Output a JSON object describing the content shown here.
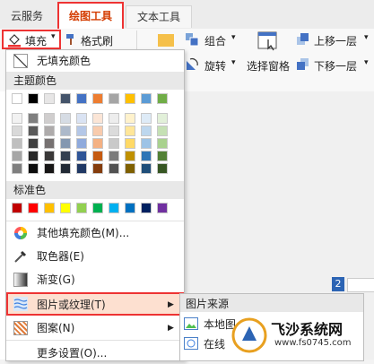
{
  "tabs": [
    "云服务",
    "绘图工具",
    "文本工具"
  ],
  "ribbon": {
    "fill_label": "填充",
    "format_painter_label": "格式刷",
    "group_label": "组合",
    "rotate_label": "旋转",
    "selection_pane_label": "选择窗格",
    "bring_forward_label": "上移一层",
    "send_backward_label": "下移一层"
  },
  "menu": {
    "no_fill": "无填充颜色",
    "theme_colors": "主题颜色",
    "standard_colors": "标准色",
    "more_colors": "其他填充颜色(M)...",
    "eyedropper": "取色器(E)",
    "gradient": "渐变(G)",
    "picture_texture": "图片或纹理(T)",
    "pattern": "图案(N)",
    "more_settings": "更多设置(O)..."
  },
  "submenu": {
    "header": "图片来源",
    "local": "本地图",
    "online": "在线"
  },
  "status": {
    "page_number": "2"
  },
  "watermark": {
    "name": "飞沙系统网",
    "url": "www.fs0745.com"
  },
  "colors": {
    "theme_top": [
      "#ffffff",
      "#000000",
      "#e7e6e6",
      "#44546a",
      "#4472c4",
      "#ed7d31",
      "#a5a5a5",
      "#ffc000",
      "#5b9bd5",
      "#70ad47"
    ],
    "theme_shades": [
      [
        "#f2f2f2",
        "#7f7f7f",
        "#d0cece",
        "#d6dce4",
        "#dae3f3",
        "#fbe5d6",
        "#ededed",
        "#fff2cc",
        "#deebf7",
        "#e2f0d9"
      ],
      [
        "#d9d9d9",
        "#595959",
        "#aeabab",
        "#adb9ca",
        "#b4c7e7",
        "#f8cbad",
        "#dbdbdb",
        "#ffe699",
        "#bdd7ee",
        "#c5e0b4"
      ],
      [
        "#bfbfbf",
        "#404040",
        "#767171",
        "#8497b0",
        "#8faadc",
        "#f4b183",
        "#c9c9c9",
        "#ffd966",
        "#9dc3e6",
        "#a9d18e"
      ],
      [
        "#a6a6a6",
        "#262626",
        "#3a3838",
        "#333f50",
        "#2f5597",
        "#c55a11",
        "#7b7b7b",
        "#bf9000",
        "#2e75b6",
        "#538135"
      ],
      [
        "#7f7f7f",
        "#0d0d0d",
        "#171616",
        "#222a35",
        "#203864",
        "#843c0c",
        "#525252",
        "#7f6000",
        "#1f4e79",
        "#375623"
      ]
    ],
    "standard": [
      "#c00000",
      "#ff0000",
      "#ffc000",
      "#ffff00",
      "#92d050",
      "#00b050",
      "#00b0f0",
      "#0070c0",
      "#002060",
      "#7030a0"
    ],
    "highlight_border": "#e33333",
    "highlight_fill": "#fde0d0"
  }
}
